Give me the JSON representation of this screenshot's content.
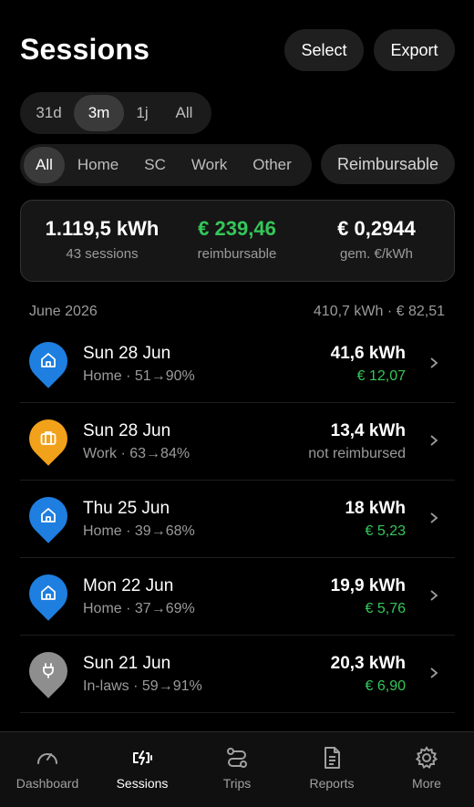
{
  "header": {
    "title": "Sessions",
    "select_label": "Select",
    "export_label": "Export"
  },
  "range_filter": {
    "options": [
      "31d",
      "3m",
      "1j",
      "All"
    ],
    "selected": "3m"
  },
  "category_filter": {
    "options": [
      "All",
      "Home",
      "SC",
      "Work",
      "Other"
    ],
    "selected": "All"
  },
  "reimbursable_filter": {
    "label": "Reimbursable"
  },
  "summary": {
    "energy": "1.119,5 kWh",
    "sessions": "43 sessions",
    "reimbursable_amount": "€ 239,46",
    "reimbursable_label": "reimbursable",
    "avg_price": "€ 0,2944",
    "avg_price_label": "gem. €/kWh"
  },
  "month_group": {
    "label": "June 2026",
    "totals": "410,7 kWh · € 82,51"
  },
  "sessions": [
    {
      "title": "Sun 28 Jun",
      "subtitle": "Home · 51→90%",
      "energy": "41,6 kWh",
      "cost": "€ 12,07",
      "icon": "home-icon",
      "color": "#1e7fe0"
    },
    {
      "title": "Sun 28 Jun",
      "subtitle": "Work · 63→84%",
      "energy": "13,4 kWh",
      "cost": "not reimbursed",
      "icon": "briefcase-icon",
      "color": "#f2a11a"
    },
    {
      "title": "Thu 25 Jun",
      "subtitle": "Home · 39→68%",
      "energy": "18 kWh",
      "cost": "€ 5,23",
      "icon": "home-icon",
      "color": "#1e7fe0"
    },
    {
      "title": "Mon 22 Jun",
      "subtitle": "Home · 37→69%",
      "energy": "19,9 kWh",
      "cost": "€ 5,76",
      "icon": "home-icon",
      "color": "#1e7fe0"
    },
    {
      "title": "Sun 21 Jun",
      "subtitle": "In-laws · 59→91%",
      "energy": "20,3 kWh",
      "cost": "€ 6,90",
      "icon": "plug-icon",
      "color": "#8e8e8e"
    }
  ],
  "tabbar": {
    "items": [
      {
        "label": "Dashboard",
        "icon": "gauge-icon"
      },
      {
        "label": "Sessions",
        "icon": "charging-icon"
      },
      {
        "label": "Trips",
        "icon": "route-icon"
      },
      {
        "label": "Reports",
        "icon": "document-icon"
      },
      {
        "label": "More",
        "icon": "gear-icon"
      }
    ],
    "active": "Sessions"
  },
  "colors": {
    "accent_green": "#34c759",
    "background": "#000000"
  }
}
